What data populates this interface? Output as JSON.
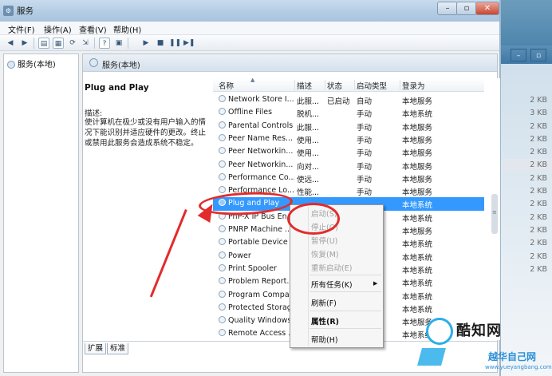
{
  "window": {
    "title": "服务"
  },
  "menu": [
    "文件(F)",
    "操作(A)",
    "查看(V)",
    "帮助(H)"
  ],
  "tree": {
    "root": "服务(本地)"
  },
  "panel_header": "服务(本地)",
  "selected_service": {
    "name": "Plug and Play",
    "desc_label": "描述:",
    "desc": "使计算机在极少或没有用户输入的情况下能识别并适应硬件的更改。终止或禁用此服务会造成系统不稳定。"
  },
  "columns": [
    "名称",
    "描述",
    "状态",
    "启动类型",
    "登录为"
  ],
  "rows": [
    {
      "name": "Network Store I...",
      "desc": "此服...",
      "status": "已启动",
      "start": "自动",
      "logon": "本地服务"
    },
    {
      "name": "Offline Files",
      "desc": "脱机...",
      "status": "",
      "start": "手动",
      "logon": "本地系统"
    },
    {
      "name": "Parental Controls",
      "desc": "此服...",
      "status": "",
      "start": "手动",
      "logon": "本地服务"
    },
    {
      "name": "Peer Name Res...",
      "desc": "使用...",
      "status": "",
      "start": "手动",
      "logon": "本地服务"
    },
    {
      "name": "Peer Networkin...",
      "desc": "使用...",
      "status": "",
      "start": "手动",
      "logon": "本地服务"
    },
    {
      "name": "Peer Networkin...",
      "desc": "向对...",
      "status": "",
      "start": "手动",
      "logon": "本地服务"
    },
    {
      "name": "Performance Co...",
      "desc": "使远...",
      "status": "",
      "start": "手动",
      "logon": "本地服务"
    },
    {
      "name": "Performance Lo...",
      "desc": "性能...",
      "status": "",
      "start": "手动",
      "logon": "本地服务"
    },
    {
      "name": "Plug and Play",
      "desc": "",
      "status": "",
      "start": "",
      "logon": "本地系统"
    },
    {
      "name": "PnP-X IP Bus En...",
      "desc": "",
      "status": "",
      "start": "",
      "logon": "本地系统"
    },
    {
      "name": "PNRP Machine ...",
      "desc": "",
      "status": "",
      "start": "",
      "logon": "本地服务"
    },
    {
      "name": "Portable Device ...",
      "desc": "",
      "status": "",
      "start": "",
      "logon": "本地系统"
    },
    {
      "name": "Power",
      "desc": "",
      "status": "",
      "start": "",
      "logon": "本地系统"
    },
    {
      "name": "Print Spooler",
      "desc": "",
      "status": "",
      "start": "",
      "logon": "本地系统"
    },
    {
      "name": "Problem Report...",
      "desc": "",
      "status": "",
      "start": "",
      "logon": "本地系统"
    },
    {
      "name": "Program Compa...",
      "desc": "",
      "status": "",
      "start": "",
      "logon": "本地系统"
    },
    {
      "name": "Protected Storage",
      "desc": "",
      "status": "",
      "start": "",
      "logon": "本地系统"
    },
    {
      "name": "Quality Windows...",
      "desc": "",
      "status": "",
      "start": "",
      "logon": "本地服务"
    },
    {
      "name": "Remote Access ...",
      "desc": "",
      "status": "",
      "start": "",
      "logon": "本地系统"
    }
  ],
  "context_menu": {
    "start": "启动(S)",
    "stop": "停止(O)",
    "pause": "暂停(U)",
    "resume": "恢复(M)",
    "restart": "重新启动(E)",
    "all_tasks": "所有任务(K)",
    "refresh": "刷新(F)",
    "properties": "属性(R)",
    "help": "帮助(H)"
  },
  "tabs": [
    "扩展",
    "标准"
  ],
  "background_sizes": [
    "2 KB",
    "3 KB",
    "2 KB",
    "2 KB",
    "2 KB",
    "2 KB",
    "2 KB",
    "2 KB",
    "2 KB",
    "2 KB",
    "2 KB",
    "2 KB",
    "2 KB",
    "2 KB"
  ],
  "watermark": {
    "brand": "酷知网",
    "sub": "越华自己网",
    "url": "www.yueyangbang.com"
  },
  "colors": {
    "selection": "#3399ff",
    "annotation": "#e32b2b",
    "watermark": "#2caeea"
  }
}
